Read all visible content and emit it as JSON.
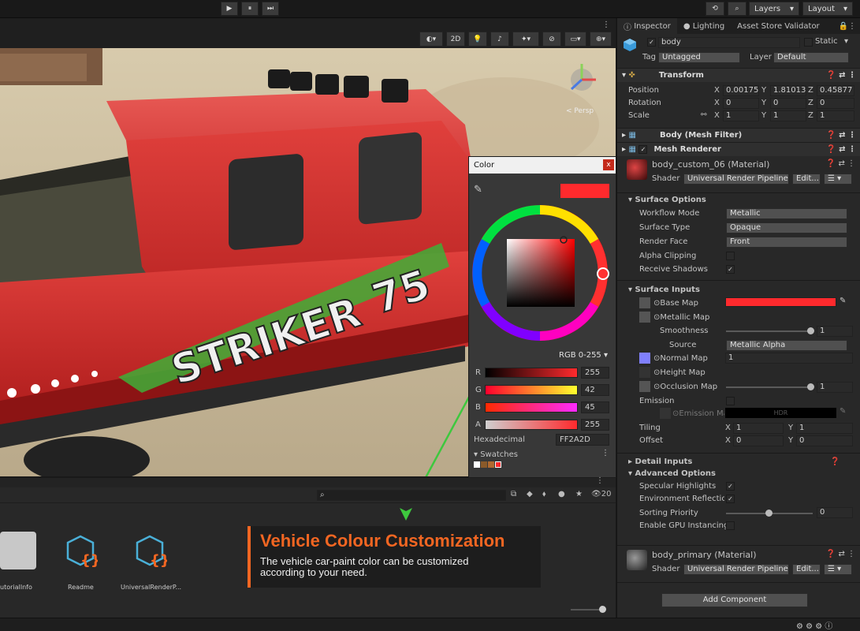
{
  "toolbar": {
    "layers": "Layers",
    "layout": "Layout",
    "play": "▶",
    "pause": "⏸",
    "step": "⏭"
  },
  "scene": {
    "mode_2d": "2D",
    "gizmo_label": "< Persp",
    "decal_left": "STRIKER",
    "decal_right": "75"
  },
  "color_picker": {
    "title": "Color",
    "close": "x",
    "mode": "RGB 0-255",
    "swatch_color": "#FF2A2D",
    "r_label": "R",
    "r_value": "255",
    "g_label": "G",
    "g_value": "42",
    "b_label": "B",
    "b_value": "45",
    "a_label": "A",
    "a_value": "255",
    "hex_label": "Hexadecimal",
    "hex_value": "FF2A2D",
    "swatches_label": "Swatches"
  },
  "project": {
    "search_count": "20",
    "items": [
      {
        "label": "utorialInfo"
      },
      {
        "label": "Readme"
      },
      {
        "label": "UniversalRenderP..."
      }
    ]
  },
  "callout": {
    "title": "Vehicle Colour Customization",
    "body": "The vehicle car-paint color can be customized according to your need.",
    "accent": "#f26622"
  },
  "inspector": {
    "tabs": [
      {
        "label": "Inspector"
      },
      {
        "label": "Lighting"
      },
      {
        "label": "Asset Store Validator"
      }
    ],
    "object_name": "body",
    "static_label": "Static",
    "tag_label": "Tag",
    "tag_value": "Untagged",
    "layer_label": "Layer",
    "layer_value": "Default",
    "transform": {
      "title": "Transform",
      "position_label": "Position",
      "pos_x": "0.00175",
      "pos_y": "1.810135",
      "pos_z": "0.45877",
      "rotation_label": "Rotation",
      "rot_x": "0",
      "rot_y": "0",
      "rot_z": "0",
      "scale_label": "Scale",
      "scl_x": "1",
      "scl_y": "1",
      "scl_z": "1",
      "x": "X",
      "y": "Y",
      "z": "Z"
    },
    "mesh_filter": "Body (Mesh Filter)",
    "mesh_renderer": "Mesh Renderer",
    "material1": {
      "name": "body_custom_06 (Material)",
      "shader_label": "Shader",
      "shader_value": "Universal Render Pipeline/",
      "edit": "Edit..."
    },
    "surface_options": {
      "title": "Surface Options",
      "workflow_label": "Workflow Mode",
      "workflow_value": "Metallic",
      "surface_type_label": "Surface Type",
      "surface_type_value": "Opaque",
      "render_face_label": "Render Face",
      "render_face_value": "Front",
      "alpha_clip_label": "Alpha Clipping",
      "receive_shadows_label": "Receive Shadows"
    },
    "surface_inputs": {
      "title": "Surface Inputs",
      "base_map": "Base Map",
      "base_color": "#FF2A2D",
      "metallic_map": "Metallic Map",
      "smoothness_label": "Smoothness",
      "smoothness_value": "1",
      "source_label": "Source",
      "source_value": "Metallic Alpha",
      "normal_map": "Normal Map",
      "normal_value": "1",
      "height_map": "Height Map",
      "occlusion_map": "Occlusion Map",
      "occlusion_value": "1",
      "emission_label": "Emission",
      "emission_map": "Emission Map",
      "hdr": "HDR",
      "tiling_label": "Tiling",
      "tiling_x": "1",
      "tiling_y": "1",
      "offset_label": "Offset",
      "offset_x": "0",
      "offset_y": "0"
    },
    "detail_inputs": "Detail Inputs",
    "advanced": {
      "title": "Advanced Options",
      "specular": "Specular Highlights",
      "env_reflections": "Environment Reflection",
      "sorting_label": "Sorting Priority",
      "sorting_value": "0",
      "gpu_instancing": "Enable GPU Instancing"
    },
    "material2": {
      "name": "body_primary (Material)",
      "shader_label": "Shader",
      "shader_value": "Universal Render Pipeline/",
      "edit": "Edit..."
    },
    "add_component": "Add Component"
  }
}
